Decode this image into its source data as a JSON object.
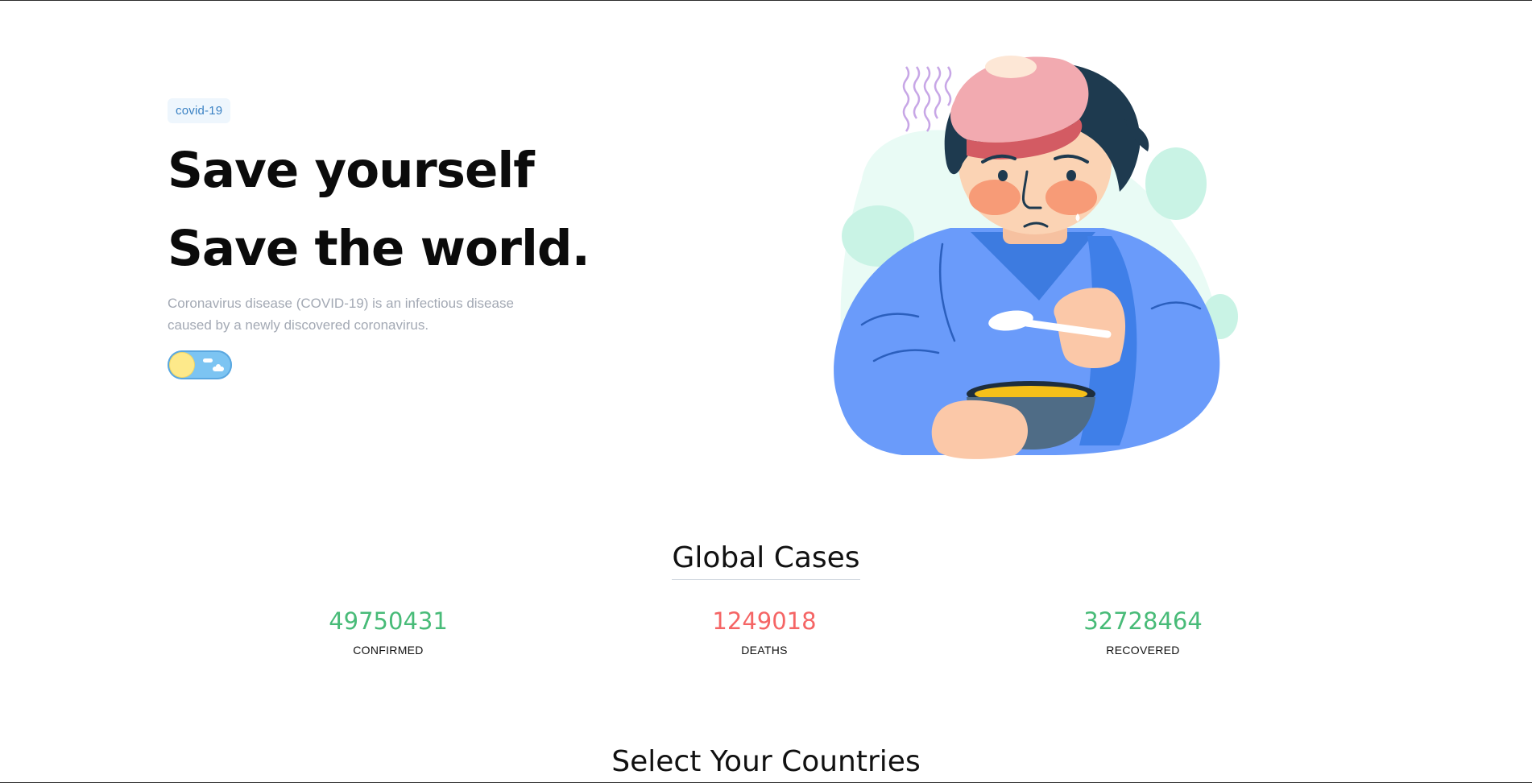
{
  "hero": {
    "tag": "covid-19",
    "headline_line1": "Save yourself",
    "headline_line2": "Save the world.",
    "description": "Coronavirus disease (COVID-19) is an infectious disease caused by a newly discovered coronavirus."
  },
  "theme_toggle": {
    "state": "light",
    "icon": "sun-cloud-icon"
  },
  "illustration": {
    "icon": "sick-person-illustration"
  },
  "global_cases": {
    "title": "Global Cases",
    "confirmed": {
      "value": "49750431",
      "label": "CONFIRMED",
      "color": "#48bb78"
    },
    "deaths": {
      "value": "1249018",
      "label": "DEATHS",
      "color": "#f56565"
    },
    "recovered": {
      "value": "32728464",
      "label": "RECOVERED",
      "color": "#48bb78"
    }
  },
  "countries": {
    "title": "Select Your Countries"
  },
  "colors": {
    "tag_text": "#3b82c4",
    "tag_bg": "#eef6fd",
    "description": "#a3a9b4",
    "toggle_bg": "#7cc4f2",
    "sun": "#fde98a"
  }
}
